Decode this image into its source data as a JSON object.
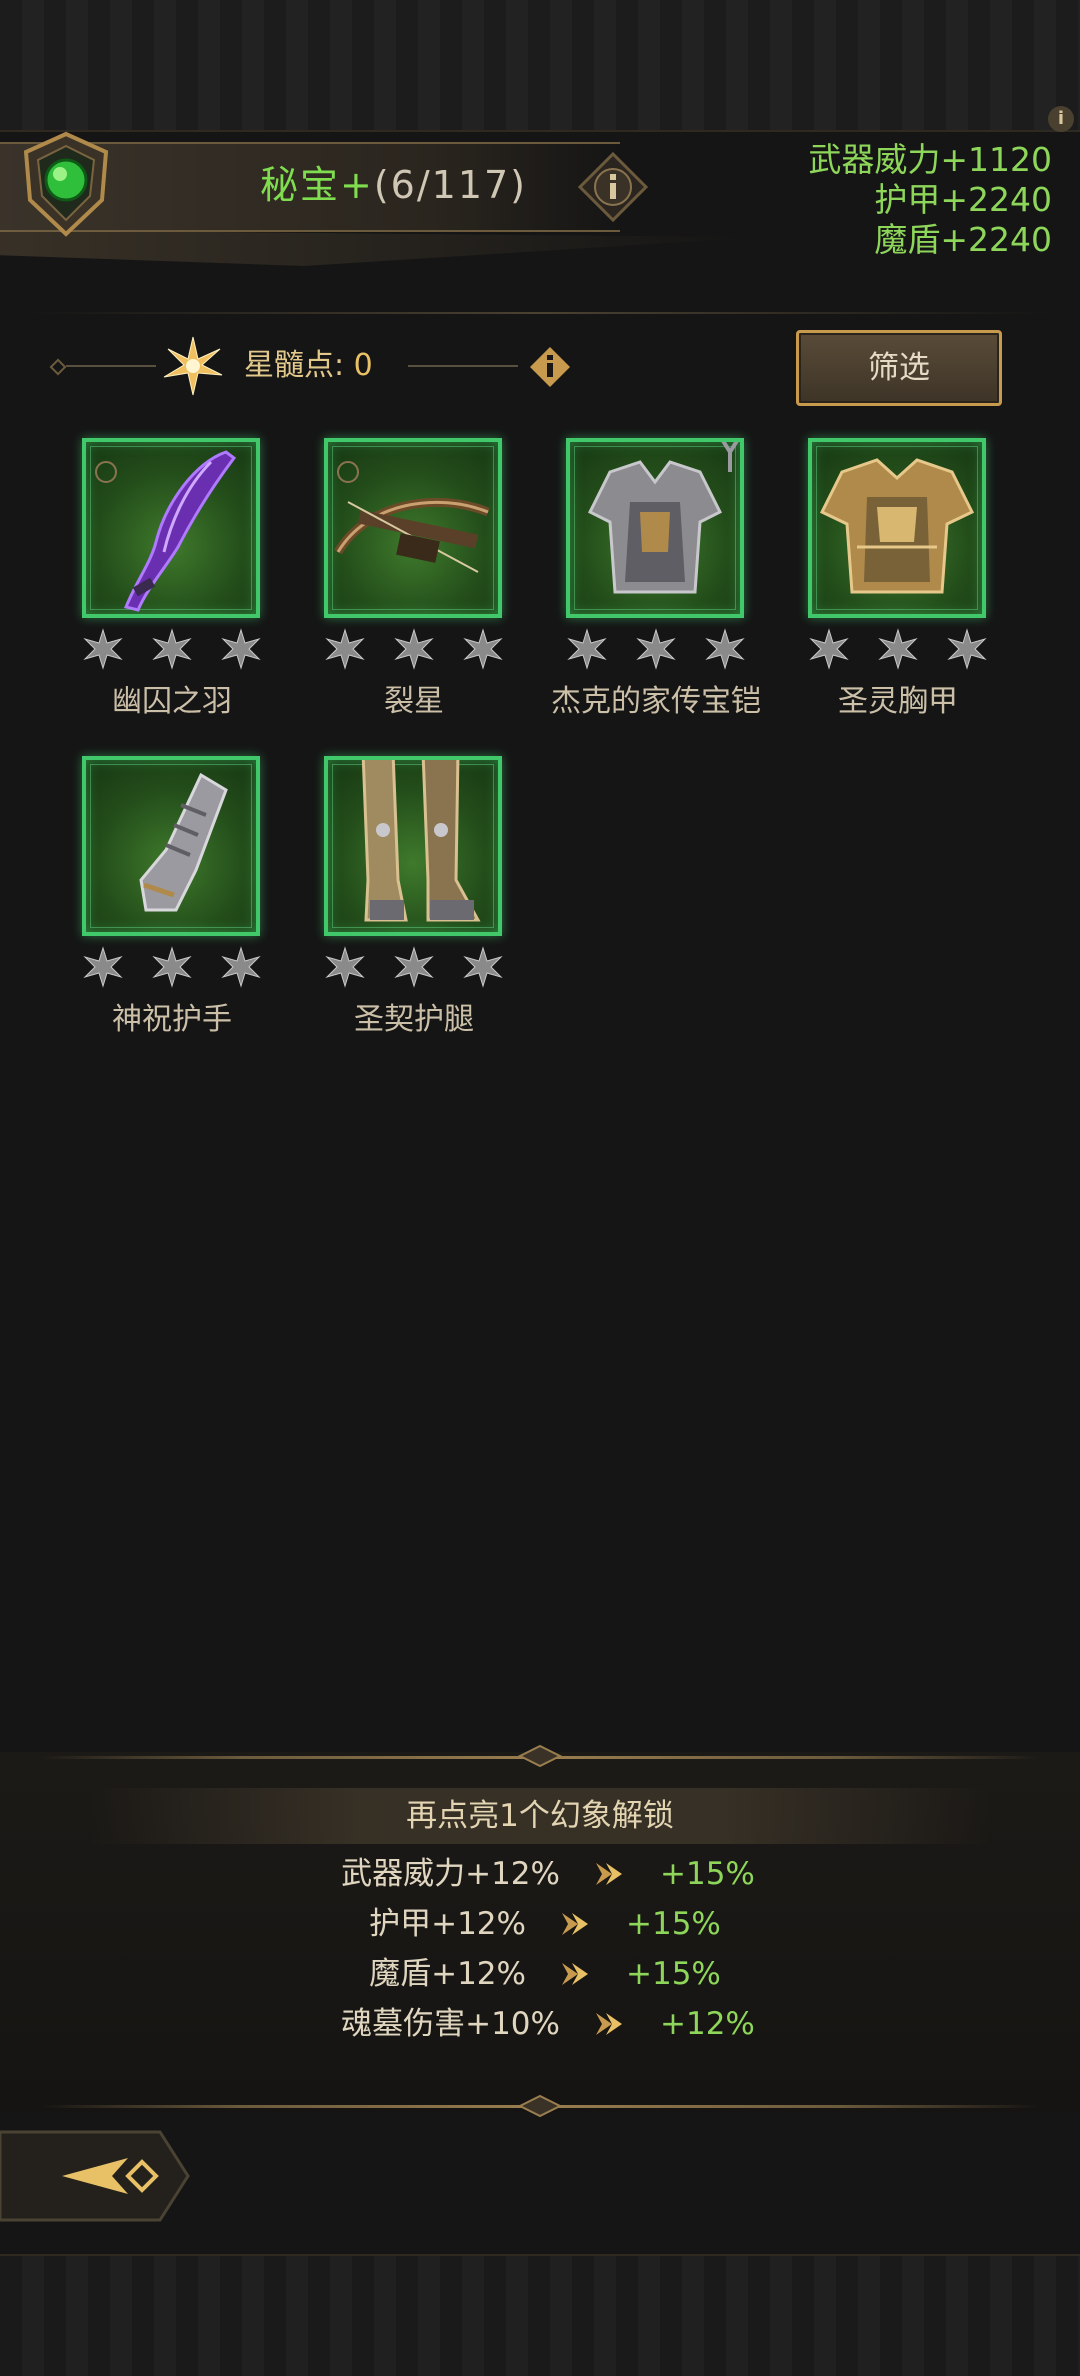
{
  "header": {
    "title": "秘宝+",
    "progress": "(6/117)",
    "stats": [
      "武器威力+1120",
      "护甲+2240",
      "魔盾+2240"
    ],
    "corner_info": "i"
  },
  "star_points": {
    "label": "星髓点:",
    "value": "0"
  },
  "filter_button": {
    "label": "筛选"
  },
  "items": [
    {
      "name": "幽囚之羽",
      "art": "purple-blade-icon",
      "stars_lit": 0
    },
    {
      "name": "裂星",
      "art": "crossbow-icon",
      "stars_lit": 0
    },
    {
      "name": "杰克的家传宝铠",
      "art": "chest-armor-icon",
      "stars_lit": 0
    },
    {
      "name": "圣灵胸甲",
      "art": "gold-chest-armor-icon",
      "stars_lit": 0
    },
    {
      "name": "神祝护手",
      "art": "gauntlet-icon",
      "stars_lit": 0
    },
    {
      "name": "圣契护腿",
      "art": "leg-armor-icon",
      "stars_lit": 0
    }
  ],
  "unlock_panel": {
    "title": "再点亮1个幻象解锁",
    "bonuses": [
      {
        "current": "武器威力+12%",
        "next": "+15%"
      },
      {
        "current": "护甲+12%",
        "next": "+15%"
      },
      {
        "current": "魔盾+12%",
        "next": "+15%"
      },
      {
        "current": "魂墓伤害+10%",
        "next": "+12%"
      }
    ]
  },
  "colors": {
    "accent_green": "#8ed65a",
    "item_border": "#41c86a",
    "gold": "#c89a4e"
  }
}
